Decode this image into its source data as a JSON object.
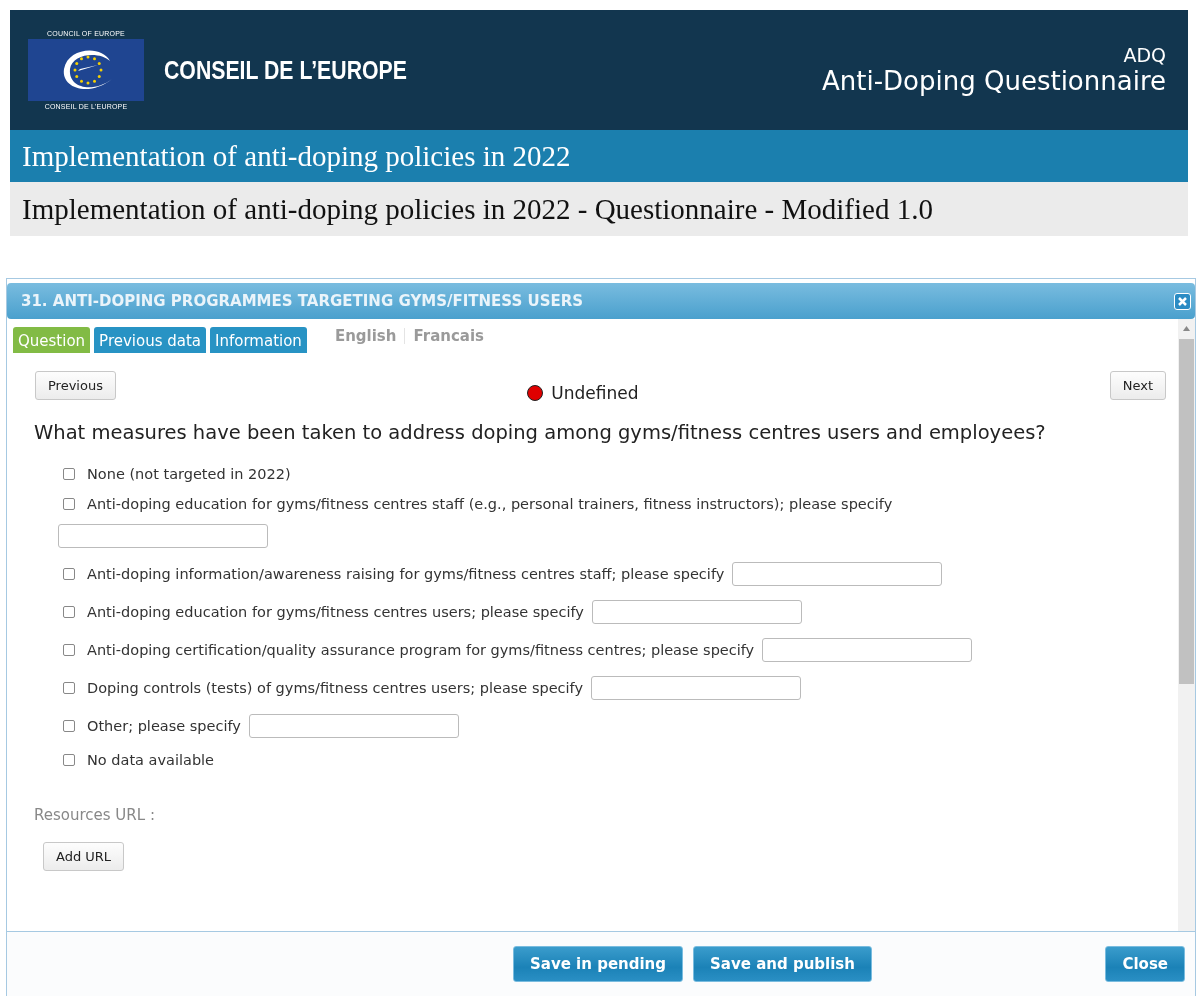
{
  "header": {
    "logo_top": "COUNCIL OF EUROPE",
    "logo_bottom": "CONSEIL DE L'EUROPE",
    "org_name": "CONSEIL DE L’EUROPE",
    "app_code": "ADQ",
    "app_name": "Anti-Doping Questionnaire"
  },
  "survey_title": "Implementation of anti-doping policies in 2022",
  "questionnaire_title": "Implementation of anti-doping policies in 2022 - Questionnaire - Modified 1.0",
  "dialog": {
    "title": "31. ANTI-DOPING PROGRAMMES TARGETING GYMS/FITNESS USERS",
    "tabs": [
      {
        "label": "Question",
        "selected": true
      },
      {
        "label": "Previous data",
        "selected": false
      },
      {
        "label": "Information",
        "selected": false
      }
    ],
    "languages": [
      "English",
      "Francais"
    ],
    "nav": {
      "previous": "Previous",
      "next": "Next"
    },
    "status": {
      "label": "Undefined",
      "color": "#e00000"
    },
    "question": "What measures have been taken to address doping among gyms/fitness centres users and employees?",
    "options": [
      {
        "kind": "plain",
        "label": "None (not targeted in 2022)",
        "checked": false
      },
      {
        "kind": "specify",
        "label": "Anti-doping education for gyms/fitness centres staff (e.g., personal trainers, fitness instructors); please specify",
        "checked": false
      },
      {
        "kind": "specify",
        "label": "Anti-doping information/awareness raising for gyms/fitness centres staff; please specify",
        "checked": false
      },
      {
        "kind": "specify",
        "label": "Anti-doping education for gyms/fitness centres users; please specify",
        "checked": false
      },
      {
        "kind": "specify",
        "label": "Anti-doping certification/quality assurance program for gyms/fitness centres; please specify",
        "checked": false
      },
      {
        "kind": "specify",
        "label": "Doping controls (tests) of gyms/fitness centres users; please specify",
        "checked": false
      },
      {
        "kind": "specify",
        "label": "Other; please specify",
        "checked": false
      },
      {
        "kind": "plain",
        "label": "No data available",
        "checked": false
      }
    ],
    "resources_label": "Resources URL :",
    "add_url": "Add URL",
    "buttons": [
      "Save in pending",
      "Save and publish"
    ],
    "close": "Close"
  }
}
